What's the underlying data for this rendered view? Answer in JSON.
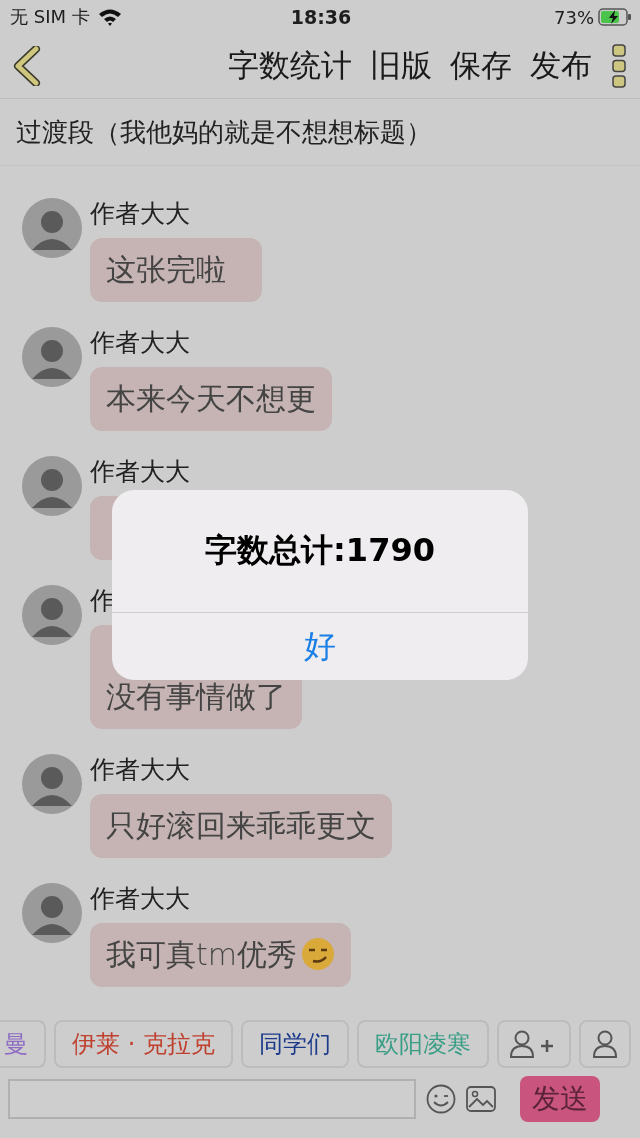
{
  "status_bar": {
    "carrier": "无 SIM 卡",
    "time": "18:36",
    "battery": "73%"
  },
  "nav": {
    "actions": [
      "字数统计",
      "旧版",
      "保存",
      "发布"
    ]
  },
  "chapter_title": "过渡段（我他妈的就是不想想标题）",
  "messages": [
    {
      "name": "作者大大",
      "lines": [
        "这张完啦"
      ],
      "covered": false
    },
    {
      "name": "作者大大",
      "lines": [
        "本来今天不想更"
      ],
      "covered": false
    },
    {
      "name": "作者大大",
      "covered": true
    },
    {
      "name": "作",
      "lines": [
        "没有事情做了"
      ],
      "covered": true
    },
    {
      "name": "作者大大",
      "lines": [
        "只好滚回来乖乖更文"
      ],
      "covered": false
    },
    {
      "name": "作者大大",
      "lines": [
        "我可真tm优秀"
      ],
      "covered": false,
      "emoji": true
    }
  ],
  "characters": [
    {
      "label": "曼",
      "color": "#8d6bc4"
    },
    {
      "label": "伊莱 · 克拉克",
      "color": "#c0402f"
    },
    {
      "label": "同学们",
      "color": "#1c3a8a"
    },
    {
      "label": "欧阳凌寒",
      "color": "#3a9e86"
    }
  ],
  "composer": {
    "send": "发送"
  },
  "alert": {
    "title": "字数总计:1790",
    "button": "好"
  }
}
